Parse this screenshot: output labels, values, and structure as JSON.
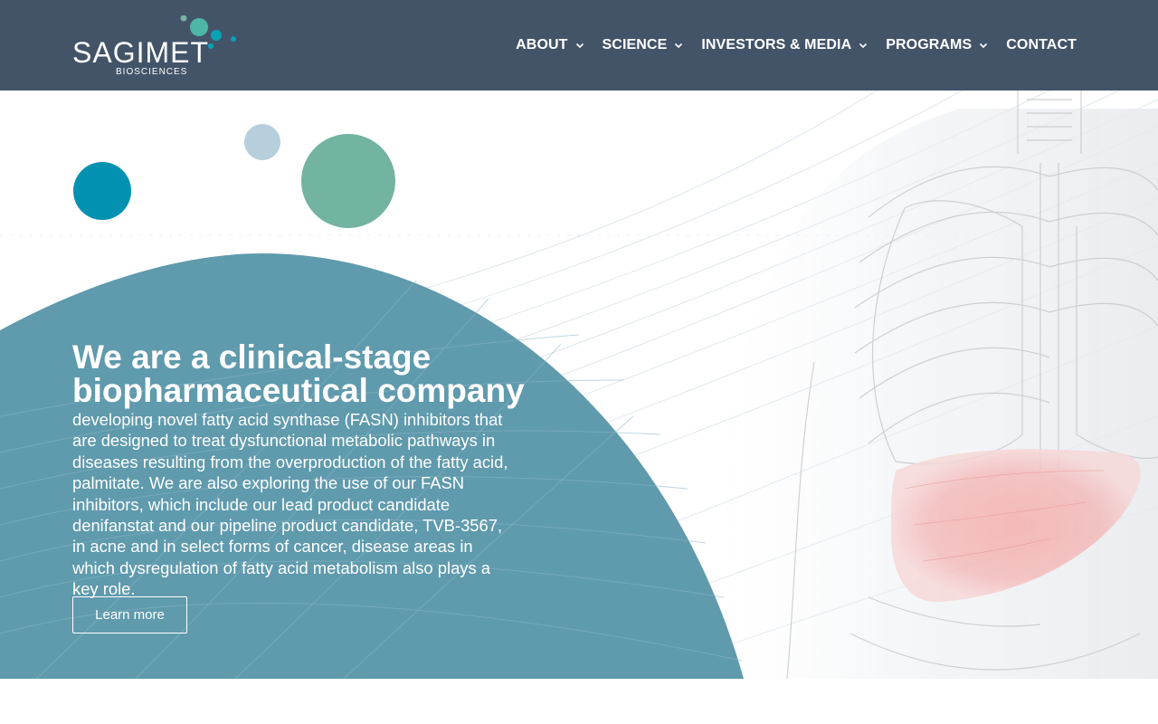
{
  "brand": {
    "name": "SAGIMET",
    "subtitle": "BIOSCIENCES",
    "colors": {
      "header_bg": "#435469",
      "teal": "#0391b1",
      "green": "#72b3a2",
      "pale_blue": "#b7cfdc",
      "hero_arc": "#5f9aad"
    }
  },
  "nav": {
    "items": [
      {
        "label": "ABOUT",
        "has_dropdown": true
      },
      {
        "label": "SCIENCE",
        "has_dropdown": true
      },
      {
        "label": "INVESTORS & MEDIA",
        "has_dropdown": true
      },
      {
        "label": "PROGRAMS",
        "has_dropdown": true
      },
      {
        "label": "CONTACT",
        "has_dropdown": false
      }
    ]
  },
  "hero": {
    "headline_line1": "We are a clinical-stage",
    "headline_line2": "biopharmaceutical company",
    "body": "developing novel fatty acid synthase (FASN) inhibitors that are designed to treat dysfunctional metabolic pathways in diseases resulting from the overproduction of the fatty acid, palmitate. We are also exploring the use of our FASN inhibitors, which include our lead product candidate denifanstat and our pipeline product candidate, TVB-3567, in acne and in select forms of cancer, disease areas in which dysregulation of fatty acid metabolism also plays a key role.",
    "cta_label": "Learn more",
    "image_icon": "anatomy-torso-liver-illustration"
  }
}
